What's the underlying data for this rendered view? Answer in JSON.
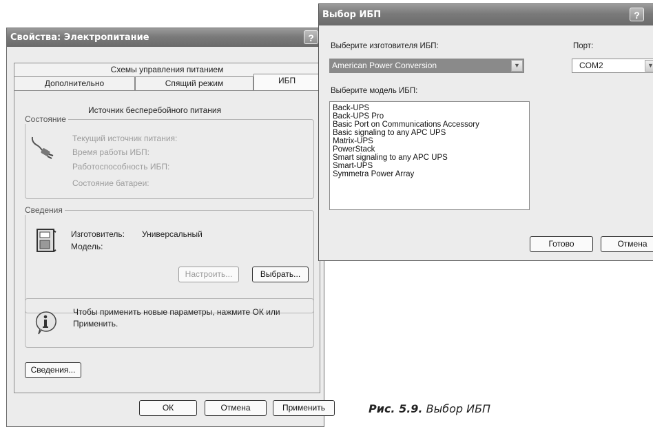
{
  "properties_dialog": {
    "title": "Свойства: Электропитание",
    "help_label": "?",
    "tabs_row1": [
      "Схемы управления питанием"
    ],
    "tabs_row2": [
      "Дополнительно",
      "Спящий режим",
      "ИБП"
    ],
    "header": "Источник бесперебойного питания",
    "status_group": {
      "title": "Состояние",
      "lines": [
        "Текущий источник питания:",
        "Время работы ИБП:",
        "Работоспособность ИБП:",
        "Состояние батареи:"
      ]
    },
    "details_group": {
      "title": "Сведения",
      "manufacturer_label": "Изготовитель:",
      "manufacturer_value": "Универсальный",
      "model_label": "Модель:",
      "configure_button": "Настроить...",
      "select_button": "Выбрать..."
    },
    "info_text_line1": "Чтобы применить новые параметры, нажмите ОК или",
    "info_text_line2": "Применить.",
    "details_button": "Сведения...",
    "ok_button": "ОК",
    "cancel_button": "Отмена",
    "apply_button": "Применить"
  },
  "ups_dialog": {
    "title": "Выбор ИБП",
    "help_label": "?",
    "manufacturer_label": "Выберите изготовителя ИБП:",
    "manufacturer_value": "American Power Conversion",
    "port_label": "Порт:",
    "port_value": "COM2",
    "model_label": "Выберите модель ИБП:",
    "models": [
      "Back-UPS",
      "Back-UPS Pro",
      "Basic Port on Communications Accessory",
      "Basic signaling to any APC UPS",
      "Matrix-UPS",
      "PowerStack",
      "Smart signaling to any APC UPS",
      "Smart-UPS",
      "Symmetra Power Array"
    ],
    "finish_button": "Готово",
    "cancel_button": "Отмена"
  },
  "figure_caption": {
    "label": "Рис. 5.9.",
    "text": "Выбор ИБП"
  }
}
